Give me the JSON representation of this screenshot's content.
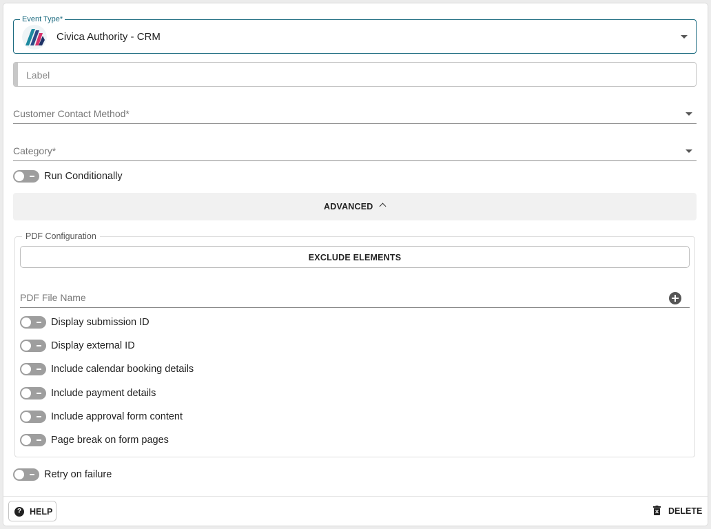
{
  "event_type": {
    "legend": "Event Type*",
    "value": "Civica Authority - CRM"
  },
  "label_field": {
    "placeholder": "Label"
  },
  "contact_method": {
    "label": "Customer Contact Method*"
  },
  "category": {
    "label": "Category*"
  },
  "run_conditionally": {
    "label": "Run Conditionally",
    "enabled": false
  },
  "advanced": {
    "label": "ADVANCED",
    "expanded": true
  },
  "pdf_config": {
    "legend": "PDF Configuration",
    "exclude_button": "EXCLUDE ELEMENTS",
    "file_name_label": "PDF File Name",
    "toggles": [
      {
        "label": "Display submission ID",
        "enabled": false
      },
      {
        "label": "Display external ID",
        "enabled": false
      },
      {
        "label": "Include calendar booking details",
        "enabled": false
      },
      {
        "label": "Include payment details",
        "enabled": false
      },
      {
        "label": "Include approval form content",
        "enabled": false
      },
      {
        "label": "Page break on form pages",
        "enabled": false
      }
    ]
  },
  "retry": {
    "label": "Retry on failure",
    "enabled": false
  },
  "footer": {
    "help_label": "HELP",
    "delete_label": "DELETE"
  },
  "colors": {
    "accent": "#1c6b80",
    "toggle_off": "#9e9e9e"
  },
  "icons": {
    "logo": "civica-logo",
    "help": "question-circle-icon",
    "delete": "trash-icon",
    "add": "plus-circle-icon"
  }
}
